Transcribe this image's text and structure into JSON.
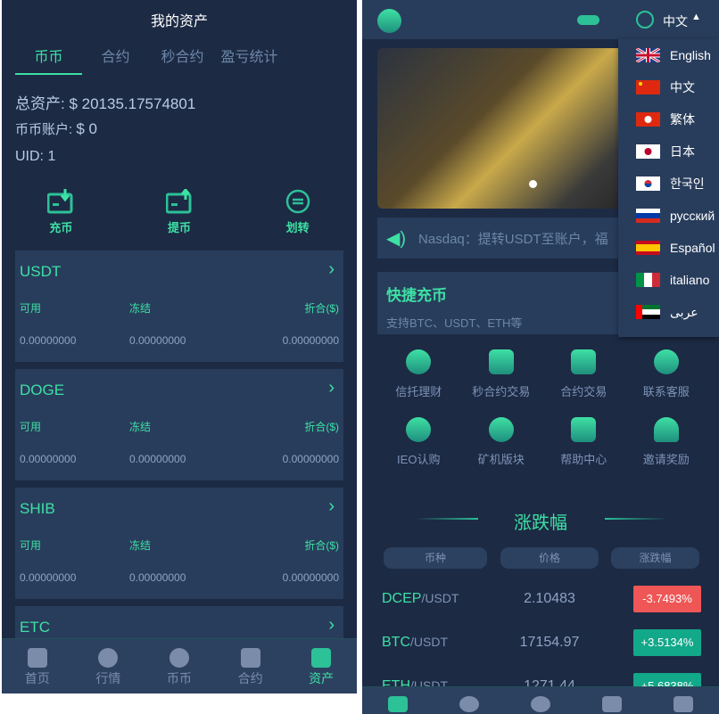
{
  "colors": {
    "accent": "#3ee0a4",
    "down": "#ef5656",
    "up": "#12a88a"
  },
  "left": {
    "title": "我的资产",
    "tabs": [
      "币币",
      "合约",
      "秒合约",
      "盈亏统计"
    ],
    "total_label": "总资产:",
    "total_value": "$ 20135.17574801",
    "account_label": "币币账户:",
    "account_value": "$ 0",
    "uid_label": "UID:",
    "uid_value": "1",
    "actions": [
      "充币",
      "提币",
      "划转"
    ],
    "col_labels": [
      "可用",
      "冻结",
      "折合($)"
    ],
    "cards": [
      {
        "name": "USDT",
        "values": [
          "0.00000000",
          "0.00000000",
          "0.00000000"
        ]
      },
      {
        "name": "DOGE",
        "values": [
          "0.00000000",
          "0.00000000",
          "0.00000000"
        ]
      },
      {
        "name": "SHIB",
        "values": [
          "0.00000000",
          "0.00000000",
          "0.00000000"
        ]
      },
      {
        "name": "ETC"
      }
    ],
    "nav": [
      "首页",
      "行情",
      "币币",
      "合约",
      "资产"
    ]
  },
  "right": {
    "lang_current": "中文",
    "languages": [
      "English",
      "中文",
      "繁体",
      "日本",
      "한국인",
      "русский",
      "Español",
      "italiano",
      "عربى"
    ],
    "notice": "Nasdaq：提转USDT至账户，福",
    "quick_title": "快捷充币",
    "quick_sub": "支持BTC、USDT、ETH等",
    "grid": [
      "信托理财",
      "秒合约交易",
      "合约交易",
      "联系客服",
      "IEO认购",
      "矿机版块",
      "帮助中心",
      "邀请奖励"
    ],
    "section_title": "涨跌幅",
    "headers": [
      "币种",
      "价格",
      "涨跌幅"
    ],
    "rows": [
      {
        "base": "DCEP",
        "quote": "/USDT",
        "price": "2.10483",
        "change": "-3.7493%",
        "dir": "down"
      },
      {
        "base": "BTC",
        "quote": "/USDT",
        "price": "17154.97",
        "change": "+3.5134%",
        "dir": "up"
      },
      {
        "base": "ETH",
        "quote": "/USDT",
        "price": "1271.44",
        "change": "+5.6838%",
        "dir": "up"
      }
    ]
  }
}
